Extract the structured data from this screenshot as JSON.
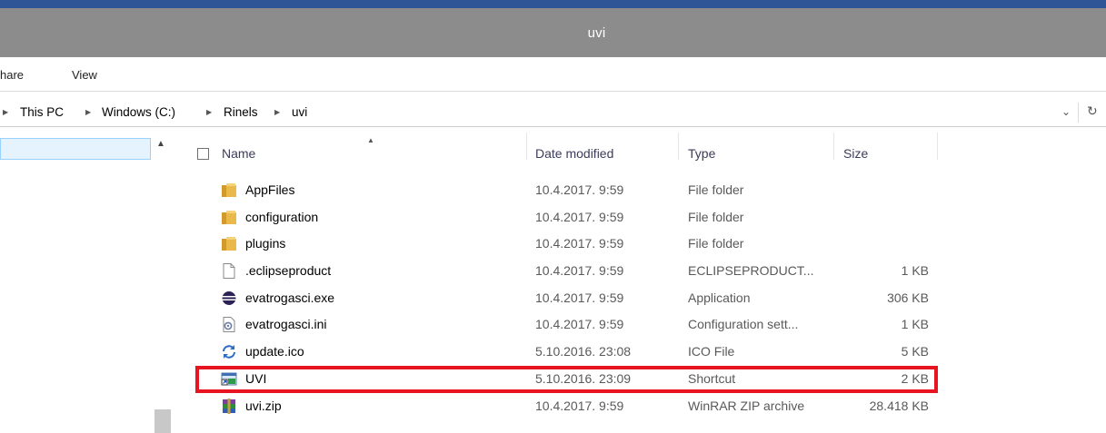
{
  "window": {
    "title": "uvi"
  },
  "ribbon": {
    "share_label": "hare",
    "view_label": "View"
  },
  "address": {
    "crumbs": [
      "This PC",
      "Windows (C:)",
      "Rinels",
      "uvi"
    ],
    "dropdown_glyph": "⌄",
    "refresh_glyph": "↻"
  },
  "columns": {
    "name": "Name",
    "date": "Date modified",
    "type": "Type",
    "size": "Size"
  },
  "files": [
    {
      "name": "AppFiles",
      "date": "10.4.2017. 9:59",
      "type": "File folder",
      "size": "",
      "icon": "folder-icon"
    },
    {
      "name": "configuration",
      "date": "10.4.2017. 9:59",
      "type": "File folder",
      "size": "",
      "icon": "folder-icon"
    },
    {
      "name": "plugins",
      "date": "10.4.2017. 9:59",
      "type": "File folder",
      "size": "",
      "icon": "folder-icon"
    },
    {
      "name": ".eclipseproduct",
      "date": "10.4.2017. 9:59",
      "type": "ECLIPSEPRODUCT...",
      "size": "1 KB",
      "icon": "blank-file-icon"
    },
    {
      "name": "evatrogasci.exe",
      "date": "10.4.2017. 9:59",
      "type": "Application",
      "size": "306 KB",
      "icon": "eclipse-app-icon"
    },
    {
      "name": "evatrogasci.ini",
      "date": "10.4.2017. 9:59",
      "type": "Configuration sett...",
      "size": "1 KB",
      "icon": "config-file-icon"
    },
    {
      "name": "update.ico",
      "date": "5.10.2016. 23:08",
      "type": "ICO File",
      "size": "5 KB",
      "icon": "update-arrows-icon"
    },
    {
      "name": "UVI",
      "date": "5.10.2016. 23:09",
      "type": "Shortcut",
      "size": "2 KB",
      "icon": "shortcut-icon"
    },
    {
      "name": "uvi.zip",
      "date": "10.4.2017. 9:59",
      "type": "WinRAR ZIP archive",
      "size": "28.418 KB",
      "icon": "winrar-archive-icon"
    }
  ],
  "colors": {
    "highlight": "#e8141f",
    "titlebar": "#8c8c8c",
    "topstrip": "#2f5597"
  }
}
